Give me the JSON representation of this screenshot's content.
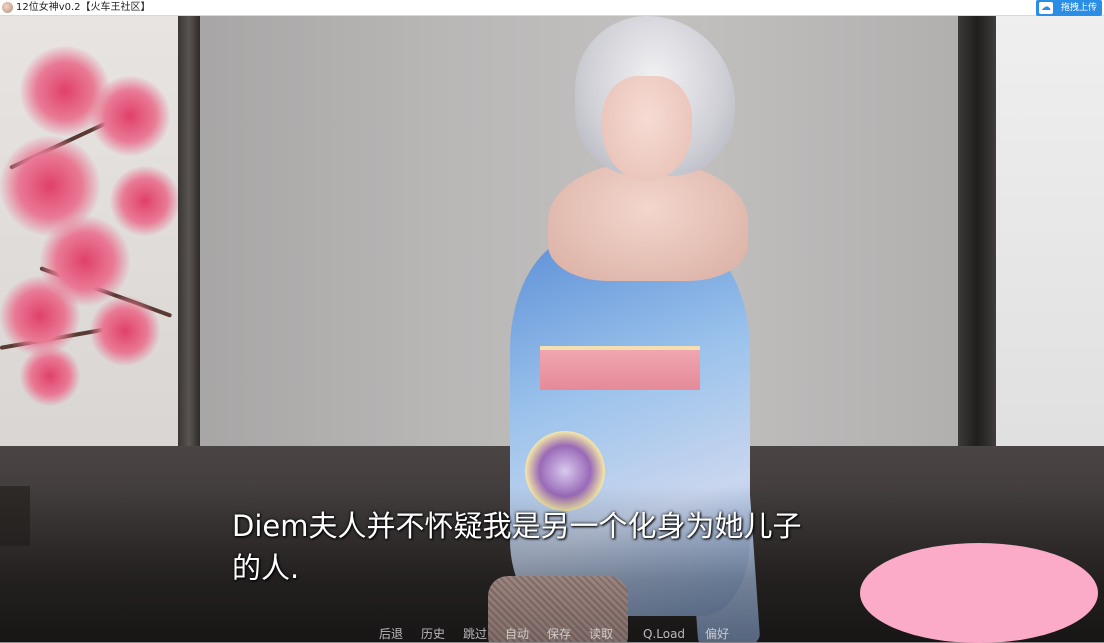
{
  "window": {
    "title": "12位女神v0.2【火车王社区】",
    "upload_button_label": "拖拽上传"
  },
  "dialogue": {
    "line1": "Diem夫人并不怀疑我是另一个化身为她儿子",
    "line2": "的人."
  },
  "quick_menu": [
    {
      "label": "后退"
    },
    {
      "label": "历史"
    },
    {
      "label": "跳过"
    },
    {
      "label": "自动"
    },
    {
      "label": "保存"
    },
    {
      "label": "读取"
    },
    {
      "label": "Q.Load"
    },
    {
      "label": "偏好"
    }
  ],
  "colors": {
    "upload_button": "#2a8ee6",
    "overlay_blob": "#fbabc8",
    "dialogue_text": "#ffffff"
  }
}
